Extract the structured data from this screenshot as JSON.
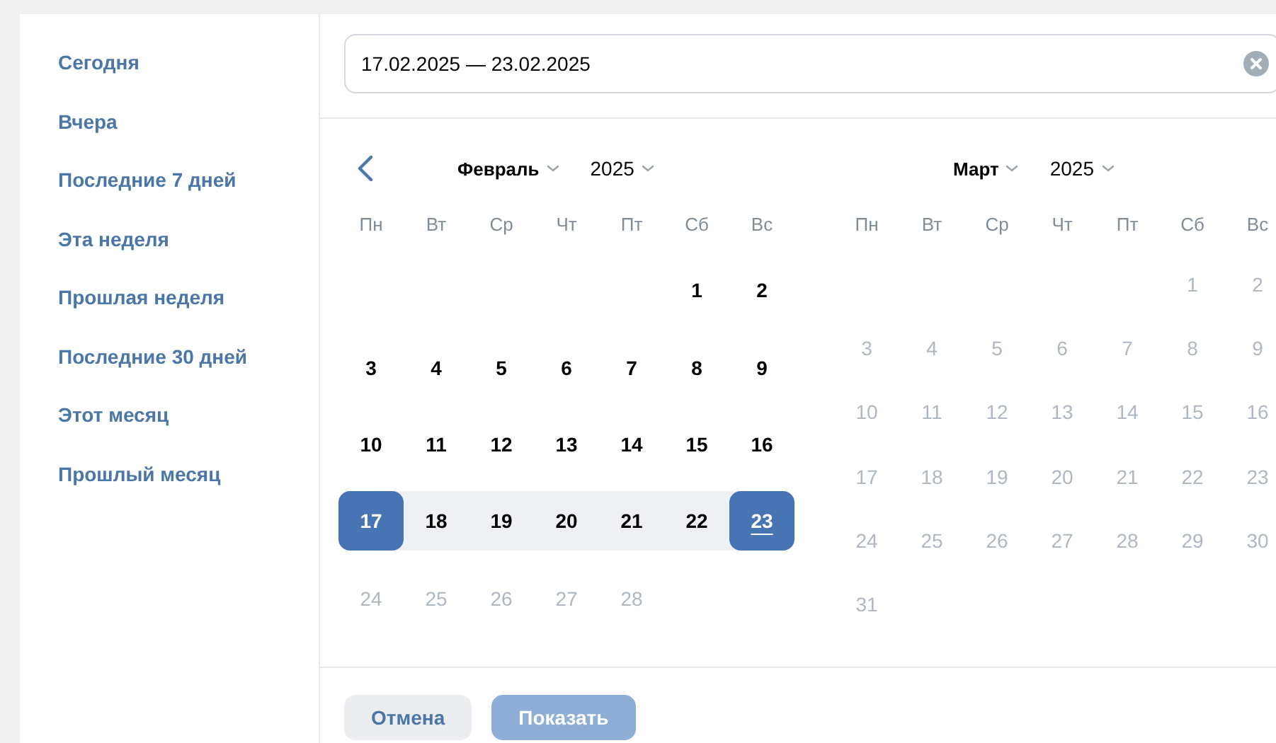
{
  "presets": [
    {
      "label": "Сегодня"
    },
    {
      "label": "Вчера"
    },
    {
      "label": "Последние 7 дней"
    },
    {
      "label": "Эта неделя"
    },
    {
      "label": "Прошлая неделя"
    },
    {
      "label": "Последние 30 дней"
    },
    {
      "label": "Этот месяц"
    },
    {
      "label": "Прошлый месяц"
    }
  ],
  "date_field": {
    "value": "17.02.2025 — 23.02.2025"
  },
  "calendars": [
    {
      "show_prev": true,
      "month": "Февраль",
      "year": "2025",
      "weekdays": [
        "Пн",
        "Вт",
        "Ср",
        "Чт",
        "Пт",
        "Сб",
        "Вс"
      ],
      "weeks": [
        {
          "kind": "leading",
          "days": [
            {
              "label": "1",
              "kind": "normal",
              "today": false
            },
            {
              "label": "2",
              "kind": "normal",
              "today": false
            }
          ]
        },
        {
          "kind": "regular",
          "days": [
            {
              "label": "3",
              "kind": "normal",
              "today": false
            },
            {
              "label": "4",
              "kind": "normal",
              "today": false
            },
            {
              "label": "5",
              "kind": "normal",
              "today": false
            },
            {
              "label": "6",
              "kind": "normal",
              "today": false
            },
            {
              "label": "7",
              "kind": "normal",
              "today": false
            },
            {
              "label": "8",
              "kind": "normal",
              "today": false
            },
            {
              "label": "9",
              "kind": "normal",
              "today": false
            }
          ]
        },
        {
          "kind": "regular",
          "days": [
            {
              "label": "10",
              "kind": "normal",
              "today": false
            },
            {
              "label": "11",
              "kind": "normal",
              "today": false
            },
            {
              "label": "12",
              "kind": "normal",
              "today": false
            },
            {
              "label": "13",
              "kind": "normal",
              "today": false
            },
            {
              "label": "14",
              "kind": "normal",
              "today": false
            },
            {
              "label": "15",
              "kind": "normal",
              "today": false
            },
            {
              "label": "16",
              "kind": "normal",
              "today": false
            }
          ]
        },
        {
          "kind": "regular",
          "days": [
            {
              "label": "17",
              "kind": "range_start",
              "today": false
            },
            {
              "label": "18",
              "kind": "in_range",
              "today": false
            },
            {
              "label": "19",
              "kind": "in_range",
              "today": false
            },
            {
              "label": "20",
              "kind": "in_range",
              "today": false
            },
            {
              "label": "21",
              "kind": "in_range",
              "today": false
            },
            {
              "label": "22",
              "kind": "in_range",
              "today": false
            },
            {
              "label": "23",
              "kind": "range_end",
              "today": true
            }
          ]
        },
        {
          "kind": "regular",
          "days": [
            {
              "label": "24",
              "kind": "disabled",
              "today": false
            },
            {
              "label": "25",
              "kind": "disabled",
              "today": false
            },
            {
              "label": "26",
              "kind": "disabled",
              "today": false
            },
            {
              "label": "27",
              "kind": "disabled",
              "today": false
            },
            {
              "label": "28",
              "kind": "disabled",
              "today": false
            }
          ]
        }
      ]
    },
    {
      "show_prev": false,
      "month": "Март",
      "year": "2025",
      "weekdays": [
        "Пн",
        "Вт",
        "Ср",
        "Чт",
        "Пт",
        "Сб",
        "Вс"
      ],
      "weeks": [
        {
          "kind": "leading",
          "days": [
            {
              "label": "1",
              "kind": "disabled",
              "today": false
            },
            {
              "label": "2",
              "kind": "disabled",
              "today": false
            }
          ]
        },
        {
          "kind": "regular",
          "days": [
            {
              "label": "3",
              "kind": "disabled",
              "today": false
            },
            {
              "label": "4",
              "kind": "disabled",
              "today": false
            },
            {
              "label": "5",
              "kind": "disabled",
              "today": false
            },
            {
              "label": "6",
              "kind": "disabled",
              "today": false
            },
            {
              "label": "7",
              "kind": "disabled",
              "today": false
            },
            {
              "label": "8",
              "kind": "disabled",
              "today": false
            },
            {
              "label": "9",
              "kind": "disabled",
              "today": false
            }
          ]
        },
        {
          "kind": "regular",
          "days": [
            {
              "label": "10",
              "kind": "disabled",
              "today": false
            },
            {
              "label": "11",
              "kind": "disabled",
              "today": false
            },
            {
              "label": "12",
              "kind": "disabled",
              "today": false
            },
            {
              "label": "13",
              "kind": "disabled",
              "today": false
            },
            {
              "label": "14",
              "kind": "disabled",
              "today": false
            },
            {
              "label": "15",
              "kind": "disabled",
              "today": false
            },
            {
              "label": "16",
              "kind": "disabled",
              "today": false
            }
          ]
        },
        {
          "kind": "regular",
          "days": [
            {
              "label": "17",
              "kind": "disabled",
              "today": false
            },
            {
              "label": "18",
              "kind": "disabled",
              "today": false
            },
            {
              "label": "19",
              "kind": "disabled",
              "today": false
            },
            {
              "label": "20",
              "kind": "disabled",
              "today": false
            },
            {
              "label": "21",
              "kind": "disabled",
              "today": false
            },
            {
              "label": "22",
              "kind": "disabled",
              "today": false
            },
            {
              "label": "23",
              "kind": "disabled",
              "today": false
            }
          ]
        },
        {
          "kind": "regular",
          "days": [
            {
              "label": "24",
              "kind": "disabled",
              "today": false
            },
            {
              "label": "25",
              "kind": "disabled",
              "today": false
            },
            {
              "label": "26",
              "kind": "disabled",
              "today": false
            },
            {
              "label": "27",
              "kind": "disabled",
              "today": false
            },
            {
              "label": "28",
              "kind": "disabled",
              "today": false
            },
            {
              "label": "29",
              "kind": "disabled",
              "today": false
            },
            {
              "label": "30",
              "kind": "disabled",
              "today": false
            }
          ]
        },
        {
          "kind": "regular",
          "days": [
            {
              "label": "31",
              "kind": "disabled",
              "today": false
            }
          ]
        }
      ]
    }
  ],
  "buttons": [
    {
      "label": "Отмена",
      "kind": "secondary",
      "disabled": false
    },
    {
      "label": "Показать",
      "kind": "primary",
      "disabled": true
    }
  ]
}
